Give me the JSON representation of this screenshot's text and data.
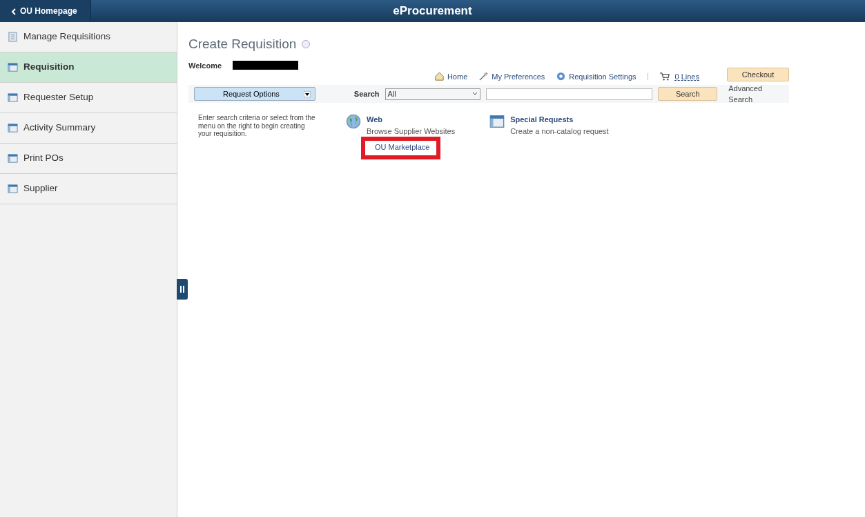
{
  "header": {
    "back_button": "OU Homepage",
    "title": "eProcurement"
  },
  "sidebar": {
    "items": [
      {
        "label": "Manage Requisitions",
        "kind": "document",
        "selected": false
      },
      {
        "label": "Requisition",
        "kind": "window",
        "selected": true
      },
      {
        "label": "Requester Setup",
        "kind": "window",
        "selected": false
      },
      {
        "label": "Activity Summary",
        "kind": "window",
        "selected": false
      },
      {
        "label": "Print POs",
        "kind": "window",
        "selected": false
      },
      {
        "label": "Supplier",
        "kind": "window",
        "selected": false
      }
    ]
  },
  "page": {
    "title": "Create Requisition",
    "welcome": "Welcome",
    "links": [
      {
        "label": "Home",
        "kind": "home"
      },
      {
        "label": "My Preferences",
        "kind": "wand"
      },
      {
        "label": "Requisition Settings",
        "kind": "gear"
      }
    ],
    "cart": "0 Lines",
    "checkout": "Checkout",
    "request_options": "Request Options",
    "search_label": "Search",
    "search_scope": "All",
    "search_button": "Search",
    "advanced_search": "Advanced Search",
    "intro": "Enter search criteria or select from the menu on the right to begin creating your requisition.",
    "sources": [
      {
        "title": "Web",
        "description": "Browse Supplier Websites",
        "kind": "globe",
        "sublinks": [
          {
            "label": "OU Marketplace",
            "highlighted": true
          }
        ]
      },
      {
        "title": "Special Requests",
        "description": "Create a non-catalog request",
        "kind": "window"
      }
    ]
  }
}
